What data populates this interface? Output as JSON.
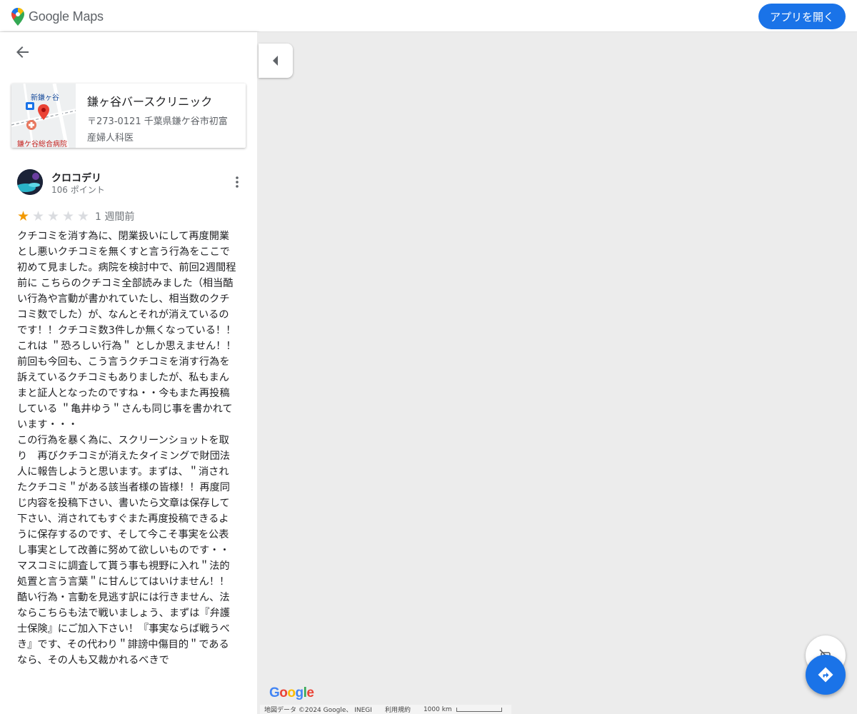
{
  "header": {
    "brand": "Google Maps",
    "open_app_label": "アプリを開く"
  },
  "place": {
    "name": "鎌ヶ谷バースクリニック",
    "address": "〒273-0121 千葉県鎌ケ谷市初富",
    "category": "産婦人科医",
    "thumb_labels": {
      "station": "新鎌ヶ谷",
      "hospital": "鎌ケ谷総合病院"
    }
  },
  "review": {
    "author": "クロコデリ",
    "points": "106 ポイント",
    "rating": 1,
    "max_rating": 5,
    "time": "1 週間前",
    "text": "クチコミを消す為に、閉業扱いにして再度開業とし悪いクチコミを無くすと言う行為をここで初めて見ました。病院を検討中で、前回2週間程前に こちらのクチコミ全部読みました（相当酷い行為や言動が書かれていたし、相当数のクチコミ数でした）が、なんとそれが消えているのです！！クチコミ数3件しか無くなっている！！\nこれは ＂恐ろしい行為＂ としか思えません！！\n前回も今回も、こう言うクチコミを消す行為を訴えているクチコミもありましたが、私もまんまと証人となったのですね・・今もまた再投稿している ＂亀井ゆう＂さんも同じ事を書かれています・・・\nこの行為を暴く為に、スクリーンショットを取り　再びクチコミが消えたタイミングで財団法人に報告しようと思います。まずは、＂消されたクチコミ＂がある該当者様の皆様！！再度同じ内容を投稿下さい、書いたら文章は保存して下さい、消されてもすぐまた再度投稿できるように保存するのです、そして今こそ事実を公表し事実として改善に努めて欲しいものです・・マスコミに調査して貰う事も視野に入れ＂法的処置と言う言葉＂に甘んじてはいけません！！\n酷い行為・言動を見逃す訳には行きません、法ならこちらも法で戦いましょう、まずは『弁護士保険』にご加入下さい！『事実ならば戦うべき』です、その代わり＂誹謗中傷目的＂であるなら、その人も又裁かれるべきで"
  },
  "map": {
    "google_logo": "Google",
    "attribution": "地図データ ©2024 Google、 INEGI",
    "terms": "利用規約",
    "scale_label": "1000 km"
  },
  "colors": {
    "accent": "#1a73e8",
    "star_on": "#f29900",
    "star_off": "#dadce0",
    "map_bg": "#ececec"
  },
  "icons": {
    "back": "arrow-left-icon",
    "more": "more-vertical-icon",
    "collapse": "caret-left-icon",
    "traffic": "traffic-off-icon",
    "directions": "directions-icon",
    "logo": "maps-pin-logo"
  }
}
